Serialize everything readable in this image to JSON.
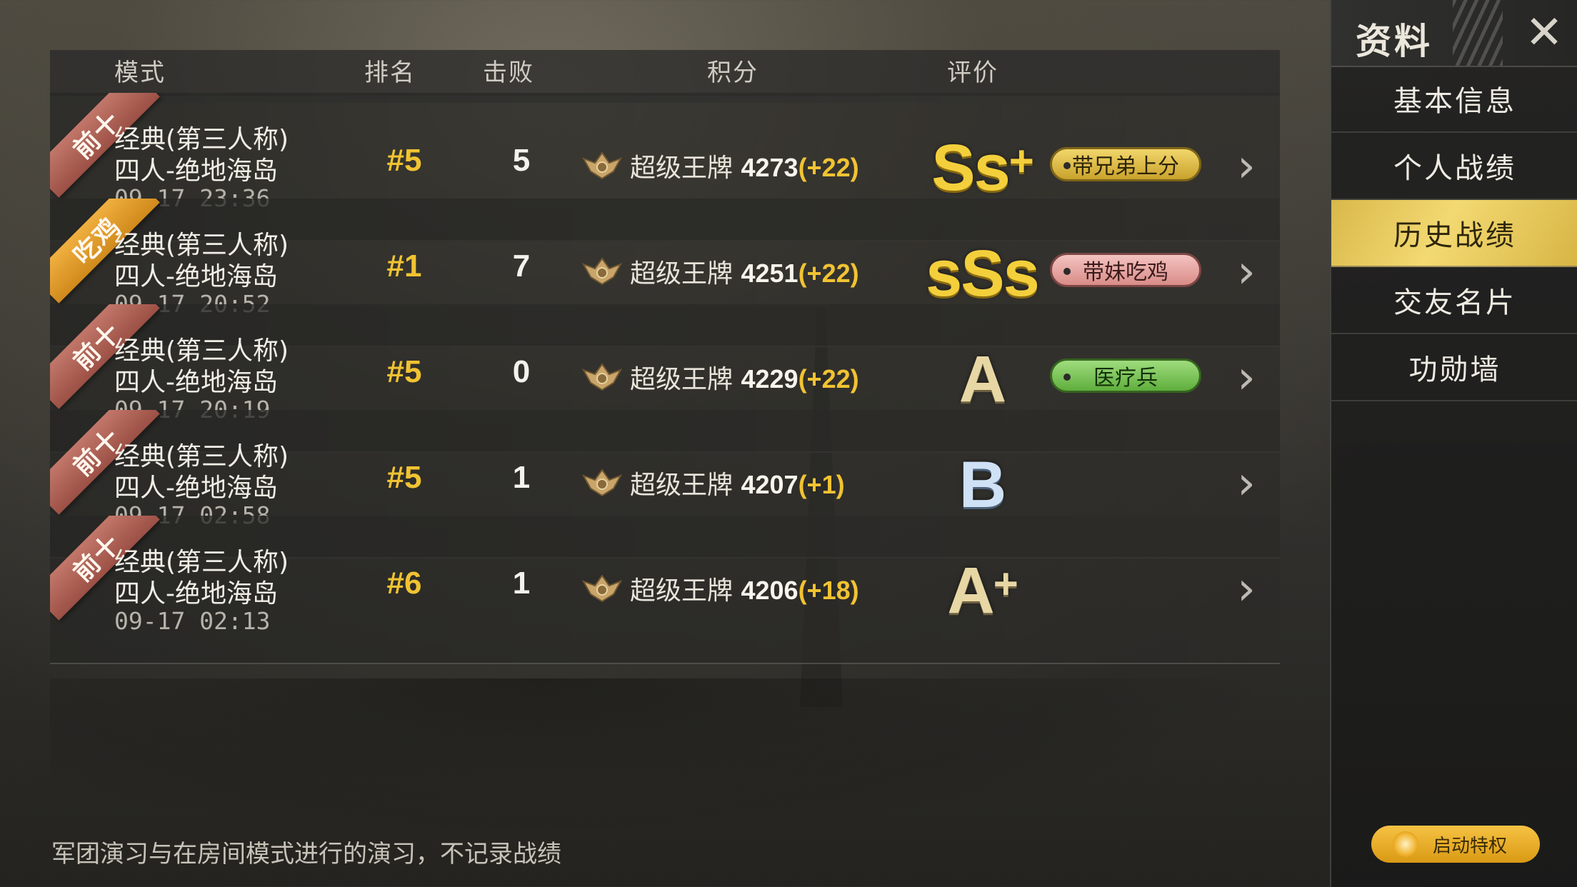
{
  "header": {
    "col_mode": "模式",
    "col_rank": "排名",
    "col_kills": "击败",
    "col_score": "积分",
    "col_rating": "评价"
  },
  "matches": [
    {
      "tag": "前十",
      "tag_type": "top10",
      "mode_line1": "经典(第三人称)",
      "mode_line2": "四人-绝地海岛",
      "time": "09-17 23:36",
      "rank": "#5",
      "kills": "5",
      "tier": "超级王牌",
      "points": "4273",
      "delta": "(+22)",
      "grade": "Ss",
      "grade_plus": "+",
      "grade_color": "#f3cf3c",
      "badge": "带兄弟上分",
      "badge_color": "yellow"
    },
    {
      "tag": "吃鸡",
      "tag_type": "win",
      "mode_line1": "经典(第三人称)",
      "mode_line2": "四人-绝地海岛",
      "time": "09-17 20:52",
      "rank": "#1",
      "kills": "7",
      "tier": "超级王牌",
      "points": "4251",
      "delta": "(+22)",
      "grade": "sSs",
      "grade_plus": "",
      "grade_color": "#f3cf3c",
      "badge": "带妹吃鸡",
      "badge_color": "pink"
    },
    {
      "tag": "前十",
      "tag_type": "top10",
      "mode_line1": "经典(第三人称)",
      "mode_line2": "四人-绝地海岛",
      "time": "09-17 20:19",
      "rank": "#5",
      "kills": "0",
      "tier": "超级王牌",
      "points": "4229",
      "delta": "(+22)",
      "grade": "A",
      "grade_plus": "",
      "grade_color": "#e7d7a4",
      "badge": "医疗兵",
      "badge_color": "green"
    },
    {
      "tag": "前十",
      "tag_type": "top10",
      "mode_line1": "经典(第三人称)",
      "mode_line2": "四人-绝地海岛",
      "time": "09-17 02:58",
      "rank": "#5",
      "kills": "1",
      "tier": "超级王牌",
      "points": "4207",
      "delta": "(+1)",
      "grade": "B",
      "grade_plus": "",
      "grade_color": "#cfe1f5",
      "badge": "",
      "badge_color": ""
    },
    {
      "tag": "前十",
      "tag_type": "top10",
      "mode_line1": "经典(第三人称)",
      "mode_line2": "四人-绝地海岛",
      "time": "09-17 02:13",
      "rank": "#6",
      "kills": "1",
      "tier": "超级王牌",
      "points": "4206",
      "delta": "(+18)",
      "grade": "A",
      "grade_plus": "+",
      "grade_color": "#e7d7a4",
      "badge": "",
      "badge_color": ""
    }
  ],
  "footnote": "军团演习与在房间模式进行的演习，不记录战绩",
  "panel": {
    "title": "资料",
    "close_icon": "close-icon",
    "nav": [
      {
        "label": "基本信息",
        "active": false
      },
      {
        "label": "个人战绩",
        "active": false
      },
      {
        "label": "历史战绩",
        "active": true
      },
      {
        "label": "交友名片",
        "active": false
      },
      {
        "label": "功勋墙",
        "active": false
      }
    ],
    "privilege_label": "启动特权"
  },
  "colors": {
    "gold_accent": "#f1c332",
    "active_nav": "#f3d972"
  }
}
